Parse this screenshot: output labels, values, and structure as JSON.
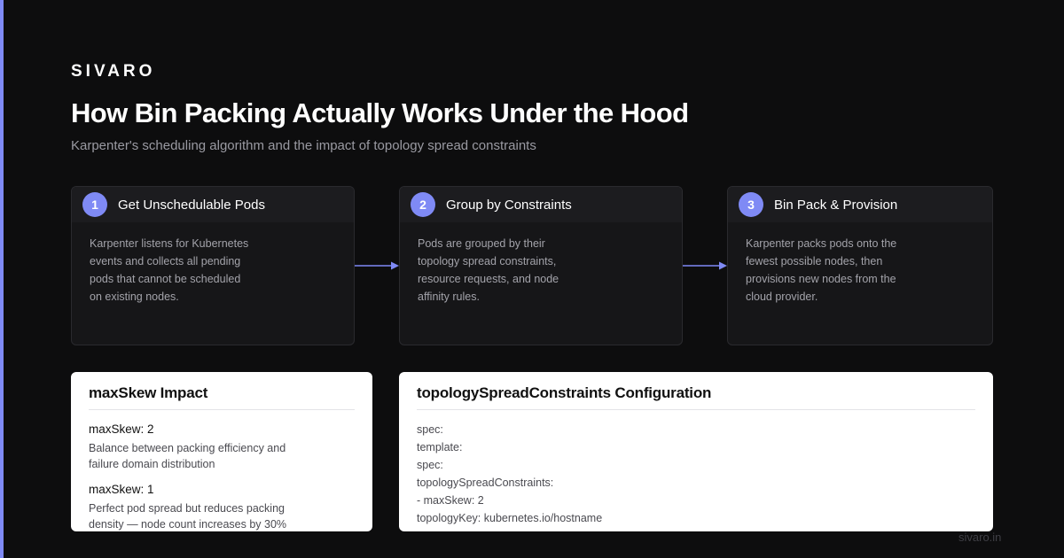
{
  "brand": "SIVARO",
  "title": "How Bin Packing Actually Works Under the Hood",
  "subtitle": "Karpenter's scheduling algorithm and the impact of topology spread constraints",
  "steps": [
    {
      "number": "1",
      "title": "Get Unschedulable Pods",
      "description": "Karpenter listens for Kubernetes events and collects all pending pods that cannot be scheduled on existing nodes."
    },
    {
      "number": "2",
      "title": "Group by Constraints",
      "description": "Pods are grouped by their topology spread constraints, resource requests, and node affinity rules."
    },
    {
      "number": "3",
      "title": "Bin Pack & Provision",
      "description": "Karpenter packs pods onto the fewest possible nodes, then provisions new nodes from the cloud provider."
    }
  ],
  "skew_card": {
    "title": "maxSkew Impact",
    "items": [
      {
        "label": "maxSkew: 2",
        "description": "Balance between packing efficiency and failure domain distribution"
      },
      {
        "label": "maxSkew: 1",
        "description": "Perfect pod spread but reduces packing density — node count increases by 30%"
      }
    ]
  },
  "config_card": {
    "title": "topologySpreadConstraints Configuration",
    "lines": [
      "spec:",
      "template:",
      "spec:",
      "topologySpreadConstraints:",
      "- maxSkew: 2",
      "topologyKey: kubernetes.io/hostname"
    ]
  },
  "footer": "sivaro.in",
  "colors": {
    "accent": "#7f8af5",
    "background": "#0d0d0e",
    "card_dark": "#161618",
    "card_light": "#ffffff"
  },
  "icons": {
    "flow_arrow": "arrow-right-icon"
  }
}
